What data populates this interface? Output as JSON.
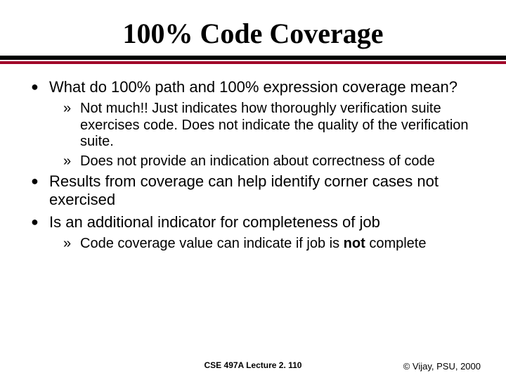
{
  "title": "100% Code Coverage",
  "bullets": {
    "b1": "What do 100% path and 100% expression coverage mean?",
    "b1a": "Not much!! Just indicates how thoroughly verification suite exercises code.  Does not indicate the quality of the verification suite.",
    "b1b": "Does not provide an indication about correctness of code",
    "b2": "Results from coverage can help identify corner cases not exercised",
    "b3": "Is an additional indicator for completeness of job",
    "b3a_pre": "Code coverage value can indicate if job is ",
    "b3a_bold": "not",
    "b3a_post": " complete"
  },
  "footer": {
    "center": "CSE 497A Lecture 2. 110",
    "right": "© Vijay, PSU, 2000"
  },
  "glyphs": {
    "dot": "●",
    "raquo": "»"
  }
}
